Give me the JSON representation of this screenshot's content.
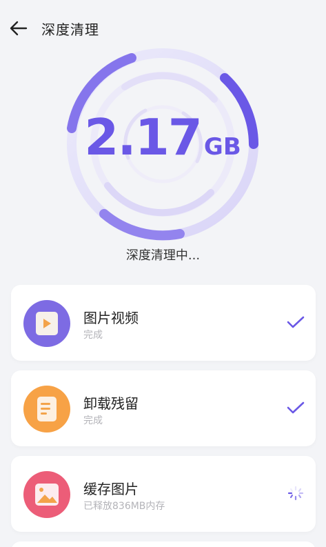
{
  "header": {
    "title": "深度清理"
  },
  "gauge": {
    "value": "2.17",
    "unit": "GB",
    "status": "深度清理中..."
  },
  "colors": {
    "accent": "#6a58e6",
    "ring_light": "#e6e3fb",
    "purple_icon": "#7d6be3",
    "orange_icon": "#f7a246",
    "red_icon": "#ec5d78"
  },
  "tasks": [
    {
      "name": "图片视频",
      "status": "完成",
      "state": "done",
      "icon": "video-icon"
    },
    {
      "name": "卸载残留",
      "status": "完成",
      "state": "done",
      "icon": "document-icon"
    },
    {
      "name": "缓存图片",
      "status": "已释放836MB内存",
      "state": "loading",
      "icon": "image-icon"
    }
  ]
}
